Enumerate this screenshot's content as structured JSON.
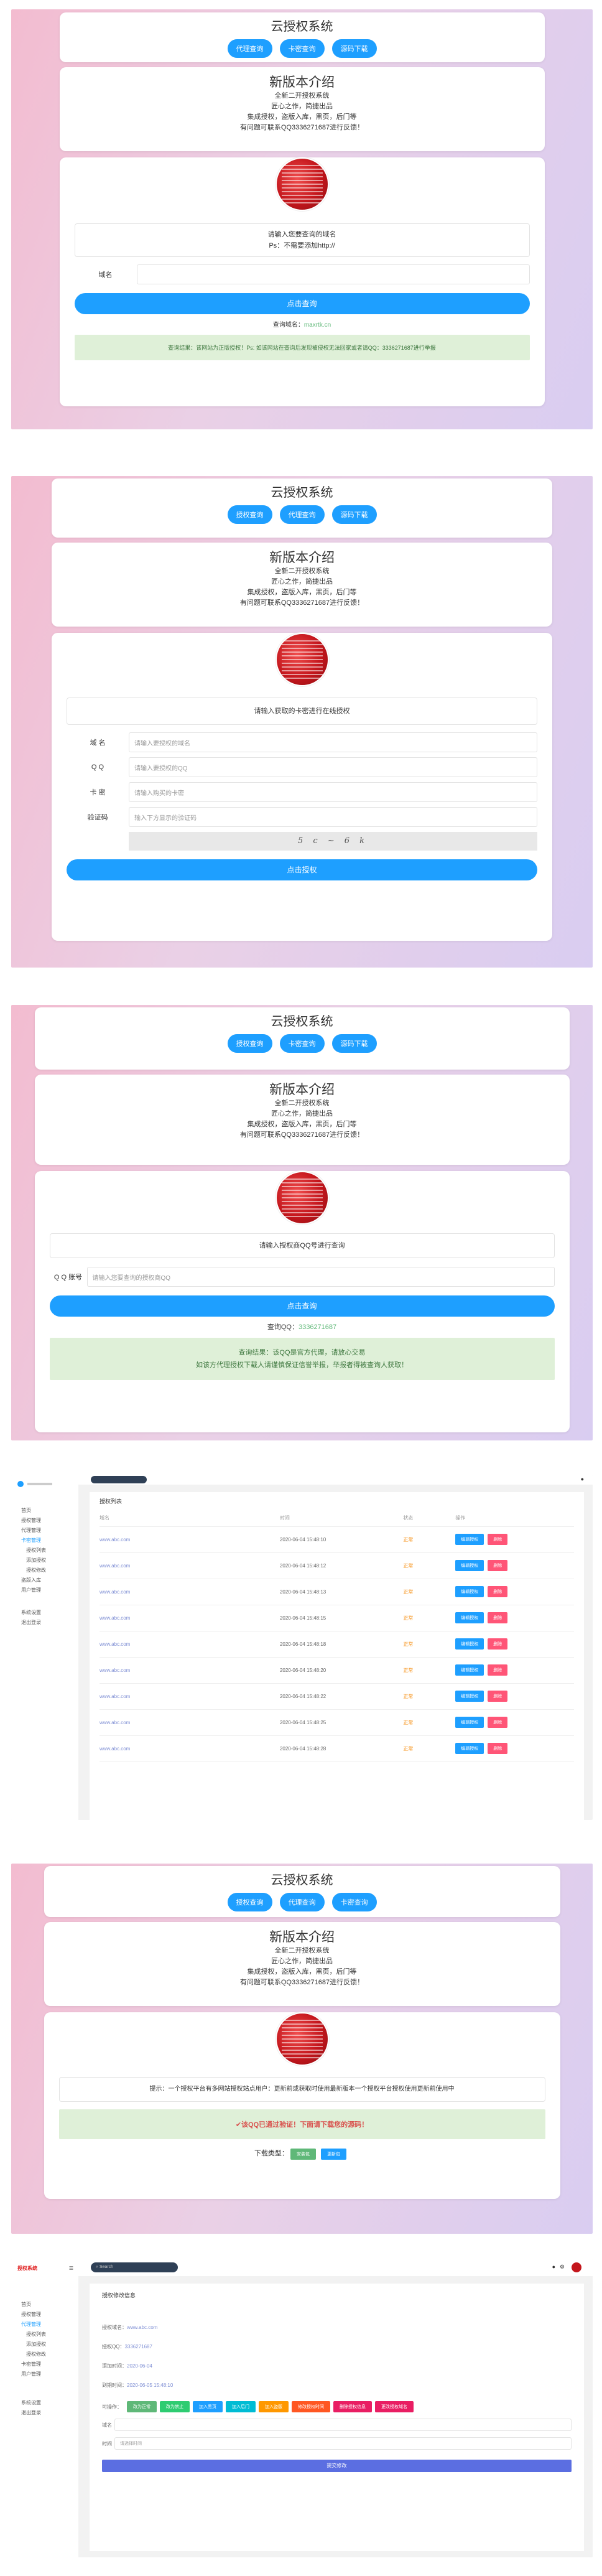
{
  "s1": {
    "title": "云授权系统",
    "buttons": [
      "代理查询",
      "卡密查询",
      "源码下载"
    ],
    "intro_title": "新版本介绍",
    "intro_lines": [
      "全新二开授权系统",
      "匠心之作，简捷出品",
      "集成授权，盗版入库，黑页，后门等",
      "有问题可联系QQ3336271687进行反馈！"
    ],
    "notice": [
      "请输入您要查询的域名",
      "Ps：不需要添加http://"
    ],
    "domain_label": "域名",
    "submit": "点击查询",
    "query_prefix": "查询域名：",
    "query_value": "maxrtk.cn",
    "result": "查询结果：该网站为正版授权！Ps: 如该网站在查询后发现被侵权无法回家或者请QQ：3336271687进行举报"
  },
  "s2": {
    "title": "云授权系统",
    "buttons": [
      "授权查询",
      "代理查询",
      "源码下载"
    ],
    "intro_title": "新版本介绍",
    "intro_lines": [
      "全新二开授权系统",
      "匠心之作，简捷出品",
      "集成授权，盗版入库，黑页，后门等",
      "有问题可联系QQ3336271687进行反馈！"
    ],
    "notice": "请输入获取的卡密进行在线授权",
    "fields": [
      {
        "label": "域 名",
        "placeholder": "请输入要授权的域名"
      },
      {
        "label": "Q Q",
        "placeholder": "请输入要授权的QQ"
      },
      {
        "label": "卡 密",
        "placeholder": "请输入购买的卡密"
      },
      {
        "label": "验证码",
        "placeholder": "输入下方显示的验证码"
      }
    ],
    "captcha": "5 c ~ 6 k",
    "submit": "点击授权"
  },
  "s3": {
    "title": "云授权系统",
    "buttons": [
      "授权查询",
      "卡密查询",
      "源码下载"
    ],
    "intro_title": "新版本介绍",
    "intro_lines": [
      "全新二开授权系统",
      "匠心之作，简捷出品",
      "集成授权，盗版入库，黑页，后门等",
      "有问题可联系QQ3336271687进行反馈！"
    ],
    "notice": "请输入授权商QQ号进行查询",
    "qq_label": "Q Q 账号",
    "qq_placeholder": "请输入您要查询的授权商QQ",
    "submit": "点击查询",
    "query_prefix": "查询QQ：",
    "query_value": "3336271687",
    "result_lines": [
      "查询结果：该QQ是官方代理，请放心交易",
      "如该方代理授权下载人请谨慎保证信誉举报，举报者得被查询人获取！"
    ]
  },
  "s4": {
    "menu": [
      "首页",
      "授权管理",
      "代理管理",
      "卡密管理",
      "盗版入库",
      "用户管理",
      "系统设置",
      "退出登录"
    ],
    "submenu": [
      "授权列表",
      "添加授权",
      "授权修改"
    ],
    "table_title": "授权列表",
    "headers": [
      "域名",
      "时间",
      "状态",
      "操作"
    ],
    "rows": [
      [
        "www.abc.com",
        "2020-06-04 15:48:10",
        "正常"
      ],
      [
        "www.abc.com",
        "2020-06-04 15:48:12",
        "正常"
      ],
      [
        "www.abc.com",
        "2020-06-04 15:48:13",
        "正常"
      ],
      [
        "www.abc.com",
        "2020-06-04 15:48:15",
        "正常"
      ],
      [
        "www.abc.com",
        "2020-06-04 15:48:18",
        "正常"
      ],
      [
        "www.abc.com",
        "2020-06-04 15:48:20",
        "正常"
      ],
      [
        "www.abc.com",
        "2020-06-04 15:48:22",
        "正常"
      ],
      [
        "www.abc.com",
        "2020-06-04 15:48:25",
        "正常"
      ],
      [
        "www.abc.com",
        "2020-06-04 15:48:28",
        "正常"
      ]
    ],
    "edit": "编辑授权",
    "delete": "删除"
  },
  "s5": {
    "title": "云授权系统",
    "buttons": [
      "授权查询",
      "代理查询",
      "卡密查询"
    ],
    "intro_title": "新版本介绍",
    "intro_lines": [
      "全新二开授权系统",
      "匠心之作，简捷出品",
      "集成授权，盗版入库，黑页，后门等",
      "有问题可联系QQ3336271687进行反馈！"
    ],
    "notice": "提示：一个授权平台有多网站授权站点用户：更新前或获取时使用最新版本一个授权平台授权使用更新前使用中",
    "ok": "✔该QQ已通过验证！下面请下载您的源码！",
    "download_label": "下载类型：",
    "download_buttons": [
      "安装包",
      "更新包"
    ]
  },
  "s6": {
    "brand": "授权系统",
    "search_placeholder": "Search",
    "menu": [
      "首页",
      "授权管理",
      "代理管理",
      "卡密管理",
      "用户管理",
      "系统设置",
      "退出登录"
    ],
    "submenu": [
      "授权列表",
      "添加授权",
      "授权修改"
    ],
    "panel_title": "授权修改信息",
    "fields": [
      {
        "label": "授权域名：",
        "value": "www.abc.com"
      },
      {
        "label": "授权QQ：",
        "value": "3336271687"
      },
      {
        "label": "添加时间：",
        "value": "2020-06-04"
      },
      {
        "label": "到期时间：",
        "value": "2020-06-05 15:48:10"
      }
    ],
    "op_label": "可操作：",
    "ops": [
      "改为正常",
      "改为禁止",
      "加入黑页",
      "加入后门",
      "加入盗版",
      "修改授权时间",
      "删除授权信息",
      "更改授权域名"
    ],
    "input1_label": "域名",
    "input2_label": "时间",
    "input2_placeholder": "请选择时间",
    "submit": "提交修改"
  }
}
